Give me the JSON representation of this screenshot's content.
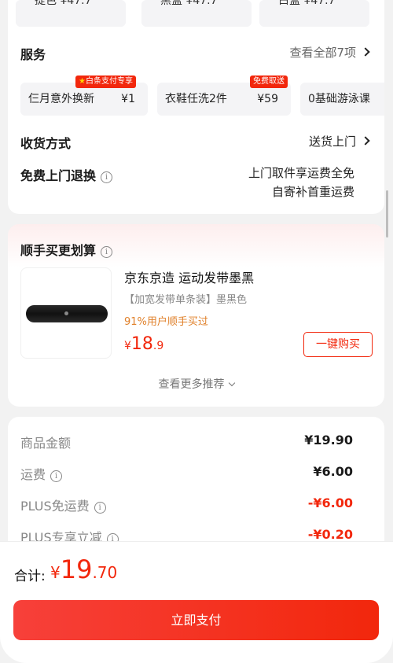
{
  "top_chips": [
    "提色 ¥47.7",
    "黑盒 ¥47.7",
    "白盒 ¥47.7"
  ],
  "services": {
    "title": "服务",
    "view_all": "查看全部7项",
    "items": [
      {
        "name": "仨月意外换新",
        "price": "¥1",
        "badge": "白条支付专享",
        "badge_star": "★"
      },
      {
        "name": "衣鞋任洗2件",
        "price": "¥59",
        "badge": "免费取送"
      },
      {
        "name": "0基础游泳课",
        "price": ""
      }
    ]
  },
  "delivery": {
    "title": "收货方式",
    "value": "送货上门"
  },
  "returns": {
    "title": "免费上门退换",
    "line1": "上门取件享运费全免",
    "line2": "自寄补首重运费"
  },
  "recommend": {
    "title": "顺手买更划算",
    "product_title": "京东京造 运动发带墨黑",
    "product_sub": "【加宽发带单条装】墨黑色",
    "percent_text": "91%用户顺手买过",
    "price_symbol": "¥",
    "price_int": "18",
    "price_dec": ".9",
    "buy_label": "一键购买",
    "more_label": "查看更多推荐"
  },
  "breakdown": [
    {
      "label": "商品金额",
      "value": "¥19.90",
      "info": false,
      "red": false
    },
    {
      "label": "运费",
      "value": "¥6.00",
      "info": true,
      "red": false
    },
    {
      "label": "PLUS免运费",
      "value": "-¥6.00",
      "info": true,
      "red": true
    },
    {
      "label": "PLUS专享立减",
      "value": "-¥0.20",
      "info": true,
      "red": true
    }
  ],
  "footer": {
    "total_label": "合计:",
    "total_symbol": "¥",
    "total_int": "19",
    "total_dec": ".70",
    "pay_label": "立即支付"
  },
  "colors": {
    "accent": "#f2270c",
    "orange": "#e0802a"
  }
}
